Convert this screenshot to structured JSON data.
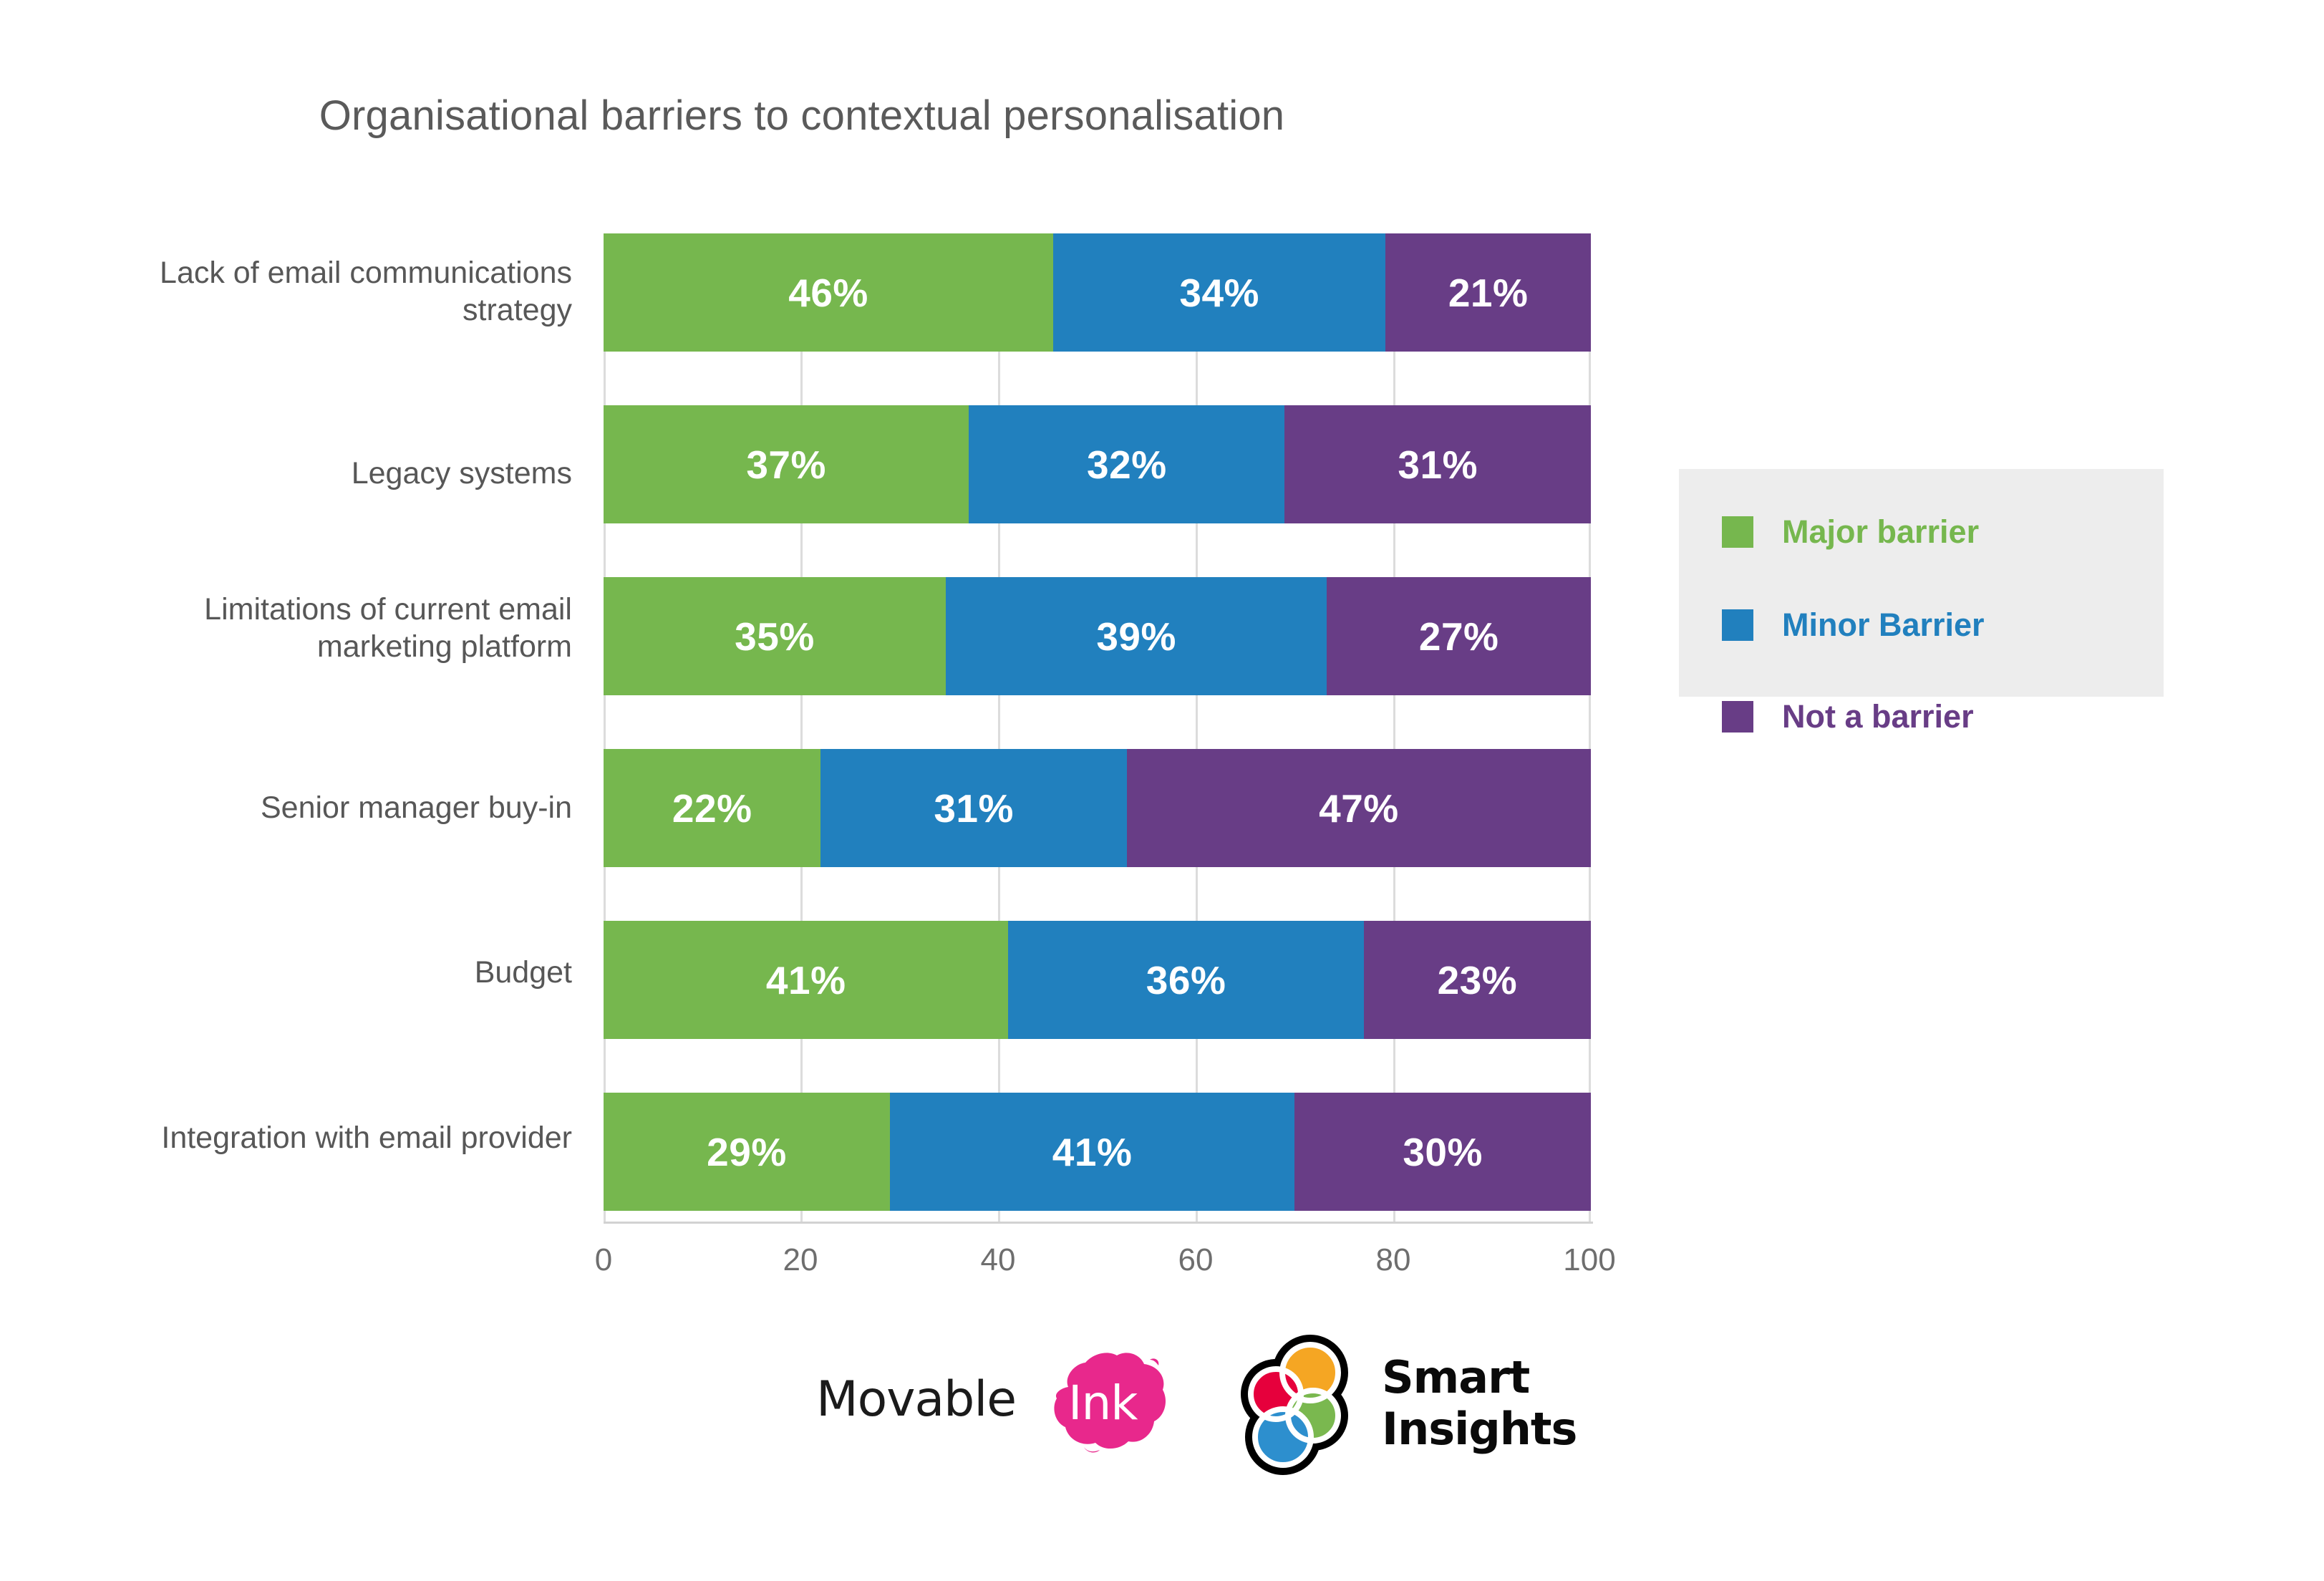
{
  "chart_data": {
    "type": "bar",
    "orientation": "horizontal",
    "stacked": true,
    "title": "Organisational barriers to contextual personalisation",
    "xlabel": "",
    "ylabel": "",
    "xlim": [
      0,
      100
    ],
    "xticks": [
      "0",
      "20",
      "40",
      "60",
      "80",
      "100"
    ],
    "grid": "vertical",
    "legend_position": "right",
    "categories": [
      "Lack of email communications strategy",
      "Legacy systems",
      "Limitations of current email marketing platform",
      "Senior manager buy-in",
      "Budget",
      "Integration with email provider"
    ],
    "series": [
      {
        "name": "Major barrier",
        "color": "#76b74e",
        "values": [
          46,
          37,
          35,
          22,
          41,
          29
        ],
        "labels": [
          "46%",
          "37%",
          "35%",
          "22%",
          "41%",
          "29%"
        ]
      },
      {
        "name": "Minor Barrier",
        "color": "#2180be",
        "values": [
          34,
          32,
          39,
          31,
          36,
          41
        ],
        "labels": [
          "34%",
          "32%",
          "39%",
          "31%",
          "36%",
          "41%"
        ]
      },
      {
        "name": "Not a barrier",
        "color": "#683d86",
        "values": [
          21,
          31,
          27,
          47,
          23,
          30
        ],
        "labels": [
          "21%",
          "31%",
          "27%",
          "47%",
          "23%",
          "30%"
        ]
      }
    ]
  },
  "category_label_lines": [
    [
      "Lack of email communications",
      "strategy"
    ],
    [
      "Legacy systems"
    ],
    [
      "Limitations of current email",
      "marketing platform"
    ],
    [
      "Senior manager buy-in"
    ],
    [
      "Budget"
    ],
    [
      "Integration with email provider"
    ]
  ],
  "legend": {
    "items": [
      {
        "label": "Major barrier",
        "color": "#76b74e"
      },
      {
        "label": "Minor Barrier",
        "color": "#2180be"
      },
      {
        "label": "Not a barrier",
        "color": "#683d86"
      }
    ],
    "background": "#ededed"
  },
  "footer": {
    "movable_ink": {
      "word": "Movable",
      "ink": "Ink",
      "splat_color": "#e8288c"
    },
    "smart_insights": {
      "line1": "Smart",
      "line2": "Insights",
      "circle_colors": {
        "top": "#f5a623",
        "left": "#e6003c",
        "right": "#7ab84f",
        "bottom": "#2d8fce"
      }
    }
  },
  "colors": {
    "title_text": "#5a5a5a",
    "axis_text": "#6e6e6e",
    "category_text": "#575757",
    "gridline": "#dcdcdc",
    "background": "#ffffff"
  }
}
